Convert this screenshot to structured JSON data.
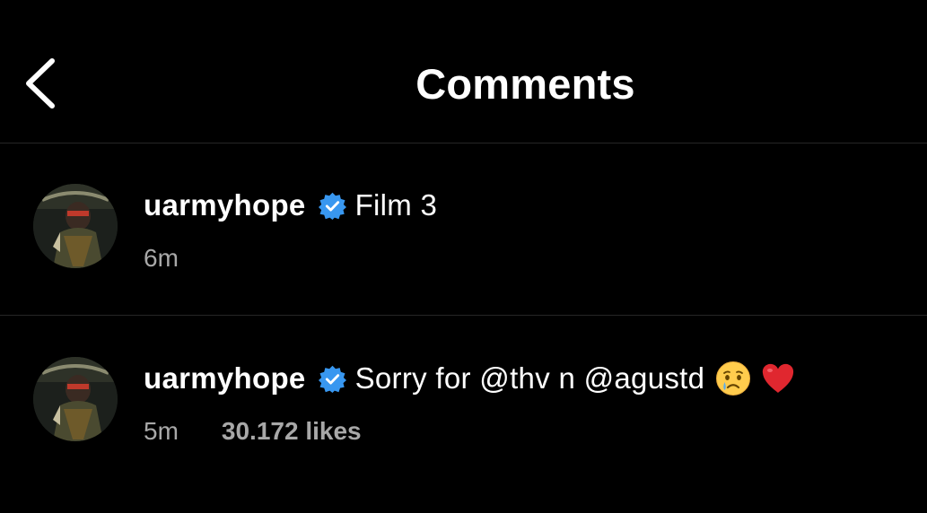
{
  "header": {
    "title": "Comments",
    "back_icon": "chevron-left-icon"
  },
  "comments": [
    {
      "username": "uarmyhope",
      "verified": true,
      "text": "Film 3",
      "time": "6m",
      "likes": ""
    },
    {
      "username": "uarmyhope",
      "verified": true,
      "text_before": "Sorry for ",
      "mention1": "@thv",
      "text_middle": " n ",
      "mention2": "@agustd",
      "emojis": [
        "crying-face-emoji",
        "red-heart-emoji"
      ],
      "time": "5m",
      "likes": "30.172 likes"
    }
  ],
  "colors": {
    "background": "#000000",
    "text": "#ffffff",
    "secondary_text": "#a8a8a8",
    "divider": "#262626",
    "verified_badge": "#3897f0"
  }
}
